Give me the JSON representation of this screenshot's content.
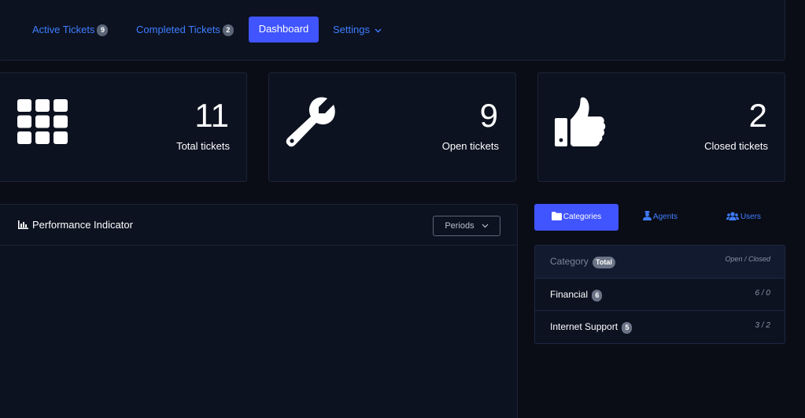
{
  "nav": {
    "active_tickets": {
      "label": "Active Tickets",
      "badge": "9"
    },
    "completed_tickets": {
      "label": "Completed Tickets",
      "badge": "2"
    },
    "dashboard": {
      "label": "Dashboard"
    },
    "settings": {
      "label": "Settings"
    }
  },
  "stats": [
    {
      "icon": "grid-icon",
      "value": "11",
      "label": "Total tickets"
    },
    {
      "icon": "wrench-icon",
      "value": "9",
      "label": "Open tickets"
    },
    {
      "icon": "thumbs-up-icon",
      "value": "2",
      "label": "Closed tickets"
    }
  ],
  "performance": {
    "title": "Performance Indicator",
    "icon": "bar-chart-icon",
    "periods_label": "Periods"
  },
  "tabs": [
    {
      "icon": "folder-icon",
      "label": "Categories",
      "active": true
    },
    {
      "icon": "agent-icon",
      "label": "Agents",
      "active": false
    },
    {
      "icon": "users-icon",
      "label": "Users",
      "active": false
    }
  ],
  "categories": {
    "header": {
      "name": "Category",
      "badge": "Total",
      "counts": "Open / Closed"
    },
    "rows": [
      {
        "name": "Financial",
        "total": "6",
        "counts": "6 / 0"
      },
      {
        "name": "Internet Support",
        "total": "5",
        "counts": "3 / 2"
      }
    ]
  },
  "colors": {
    "background": "#0a0d16",
    "panel": "#0c1220",
    "accent": "#4054ff",
    "link": "#3f7dff",
    "badge": "#5b6577"
  }
}
